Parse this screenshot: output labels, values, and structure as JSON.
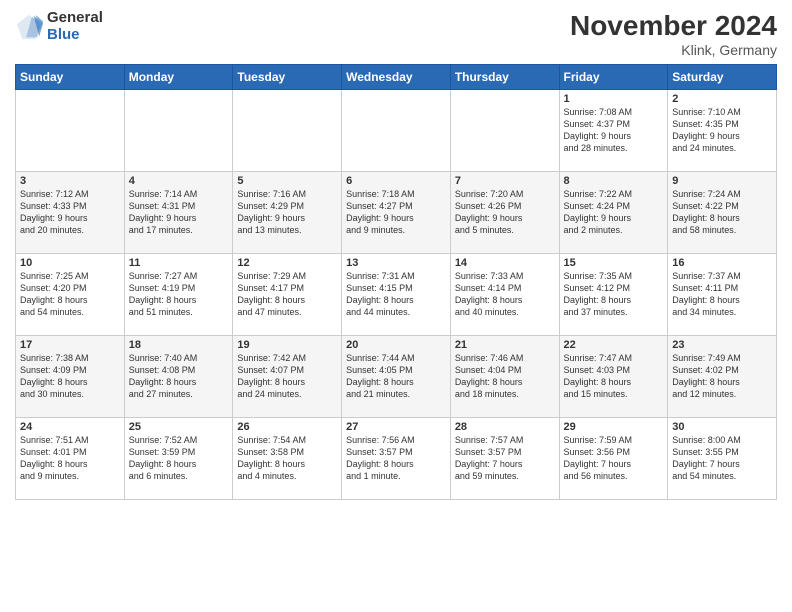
{
  "logo": {
    "general": "General",
    "blue": "Blue"
  },
  "header": {
    "month": "November 2024",
    "location": "Klink, Germany"
  },
  "weekdays": [
    "Sunday",
    "Monday",
    "Tuesday",
    "Wednesday",
    "Thursday",
    "Friday",
    "Saturday"
  ],
  "weeks": [
    [
      {
        "day": "",
        "info": ""
      },
      {
        "day": "",
        "info": ""
      },
      {
        "day": "",
        "info": ""
      },
      {
        "day": "",
        "info": ""
      },
      {
        "day": "",
        "info": ""
      },
      {
        "day": "1",
        "info": "Sunrise: 7:08 AM\nSunset: 4:37 PM\nDaylight: 9 hours\nand 28 minutes."
      },
      {
        "day": "2",
        "info": "Sunrise: 7:10 AM\nSunset: 4:35 PM\nDaylight: 9 hours\nand 24 minutes."
      }
    ],
    [
      {
        "day": "3",
        "info": "Sunrise: 7:12 AM\nSunset: 4:33 PM\nDaylight: 9 hours\nand 20 minutes."
      },
      {
        "day": "4",
        "info": "Sunrise: 7:14 AM\nSunset: 4:31 PM\nDaylight: 9 hours\nand 17 minutes."
      },
      {
        "day": "5",
        "info": "Sunrise: 7:16 AM\nSunset: 4:29 PM\nDaylight: 9 hours\nand 13 minutes."
      },
      {
        "day": "6",
        "info": "Sunrise: 7:18 AM\nSunset: 4:27 PM\nDaylight: 9 hours\nand 9 minutes."
      },
      {
        "day": "7",
        "info": "Sunrise: 7:20 AM\nSunset: 4:26 PM\nDaylight: 9 hours\nand 5 minutes."
      },
      {
        "day": "8",
        "info": "Sunrise: 7:22 AM\nSunset: 4:24 PM\nDaylight: 9 hours\nand 2 minutes."
      },
      {
        "day": "9",
        "info": "Sunrise: 7:24 AM\nSunset: 4:22 PM\nDaylight: 8 hours\nand 58 minutes."
      }
    ],
    [
      {
        "day": "10",
        "info": "Sunrise: 7:25 AM\nSunset: 4:20 PM\nDaylight: 8 hours\nand 54 minutes."
      },
      {
        "day": "11",
        "info": "Sunrise: 7:27 AM\nSunset: 4:19 PM\nDaylight: 8 hours\nand 51 minutes."
      },
      {
        "day": "12",
        "info": "Sunrise: 7:29 AM\nSunset: 4:17 PM\nDaylight: 8 hours\nand 47 minutes."
      },
      {
        "day": "13",
        "info": "Sunrise: 7:31 AM\nSunset: 4:15 PM\nDaylight: 8 hours\nand 44 minutes."
      },
      {
        "day": "14",
        "info": "Sunrise: 7:33 AM\nSunset: 4:14 PM\nDaylight: 8 hours\nand 40 minutes."
      },
      {
        "day": "15",
        "info": "Sunrise: 7:35 AM\nSunset: 4:12 PM\nDaylight: 8 hours\nand 37 minutes."
      },
      {
        "day": "16",
        "info": "Sunrise: 7:37 AM\nSunset: 4:11 PM\nDaylight: 8 hours\nand 34 minutes."
      }
    ],
    [
      {
        "day": "17",
        "info": "Sunrise: 7:38 AM\nSunset: 4:09 PM\nDaylight: 8 hours\nand 30 minutes."
      },
      {
        "day": "18",
        "info": "Sunrise: 7:40 AM\nSunset: 4:08 PM\nDaylight: 8 hours\nand 27 minutes."
      },
      {
        "day": "19",
        "info": "Sunrise: 7:42 AM\nSunset: 4:07 PM\nDaylight: 8 hours\nand 24 minutes."
      },
      {
        "day": "20",
        "info": "Sunrise: 7:44 AM\nSunset: 4:05 PM\nDaylight: 8 hours\nand 21 minutes."
      },
      {
        "day": "21",
        "info": "Sunrise: 7:46 AM\nSunset: 4:04 PM\nDaylight: 8 hours\nand 18 minutes."
      },
      {
        "day": "22",
        "info": "Sunrise: 7:47 AM\nSunset: 4:03 PM\nDaylight: 8 hours\nand 15 minutes."
      },
      {
        "day": "23",
        "info": "Sunrise: 7:49 AM\nSunset: 4:02 PM\nDaylight: 8 hours\nand 12 minutes."
      }
    ],
    [
      {
        "day": "24",
        "info": "Sunrise: 7:51 AM\nSunset: 4:01 PM\nDaylight: 8 hours\nand 9 minutes."
      },
      {
        "day": "25",
        "info": "Sunrise: 7:52 AM\nSunset: 3:59 PM\nDaylight: 8 hours\nand 6 minutes."
      },
      {
        "day": "26",
        "info": "Sunrise: 7:54 AM\nSunset: 3:58 PM\nDaylight: 8 hours\nand 4 minutes."
      },
      {
        "day": "27",
        "info": "Sunrise: 7:56 AM\nSunset: 3:57 PM\nDaylight: 8 hours\nand 1 minute."
      },
      {
        "day": "28",
        "info": "Sunrise: 7:57 AM\nSunset: 3:57 PM\nDaylight: 7 hours\nand 59 minutes."
      },
      {
        "day": "29",
        "info": "Sunrise: 7:59 AM\nSunset: 3:56 PM\nDaylight: 7 hours\nand 56 minutes."
      },
      {
        "day": "30",
        "info": "Sunrise: 8:00 AM\nSunset: 3:55 PM\nDaylight: 7 hours\nand 54 minutes."
      }
    ]
  ]
}
